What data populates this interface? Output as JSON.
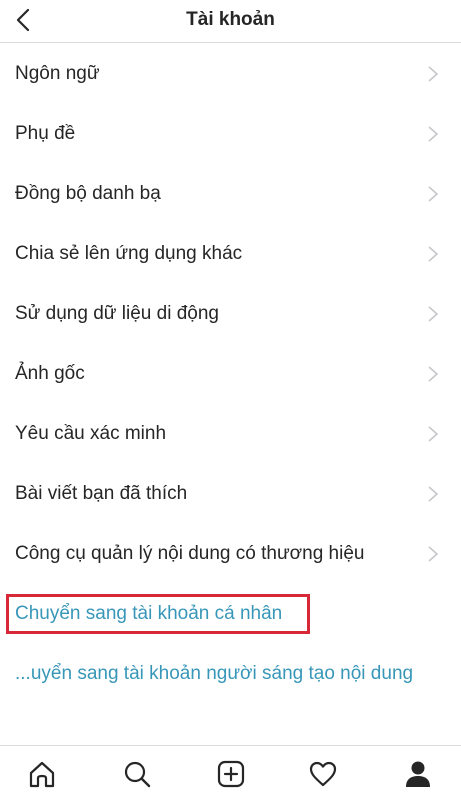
{
  "header": {
    "title": "Tài khoản",
    "back_icon": "chevron-left-icon"
  },
  "menu": {
    "items": [
      {
        "label": "Ngôn ngữ"
      },
      {
        "label": "Phụ đề"
      },
      {
        "label": "Đồng bộ danh bạ"
      },
      {
        "label": "Chia sẻ lên ứng dụng khác"
      },
      {
        "label": "Sử dụng dữ liệu di động"
      },
      {
        "label": "Ảnh gốc"
      },
      {
        "label": "Yêu cầu xác minh"
      },
      {
        "label": "Bài viết bạn đã thích"
      },
      {
        "label": "Công cụ quản lý nội dung có thương hiệu"
      }
    ],
    "chevron_icon": "chevron-right-icon"
  },
  "links": {
    "personal": "Chuyển sang tài khoản cá nhân",
    "creator": "...uyển sang tài khoản người sáng tạo nội dung"
  },
  "tabbar": {
    "icons": [
      "home-icon",
      "search-icon",
      "add-post-icon",
      "heart-icon",
      "profile-icon"
    ]
  },
  "colors": {
    "link": "#3897b8",
    "highlight": "#d62836",
    "text": "#262626",
    "divider": "#dbdbdb"
  }
}
